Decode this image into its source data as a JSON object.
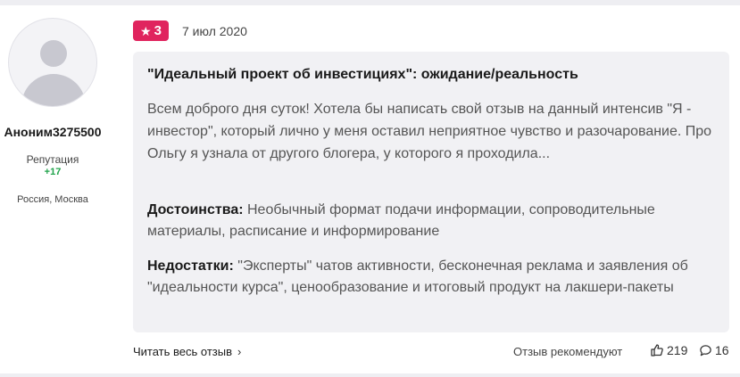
{
  "author": {
    "name": "Аноним3275500",
    "reputation_label": "Репутация",
    "reputation_value": "+17",
    "location": "Россия, Москва"
  },
  "review": {
    "rating": "3",
    "date": "7 июл 2020",
    "title": "\"Идеальный проект об инвестициях\": ожидание/реальность",
    "body": "Всем доброго дня суток! Хотела бы написать свой отзыв на данный интенсив \"Я - инвестор\", который лично у меня оставил неприятное чувство и разочарование. Про Ольгу я узнала от другого блогера, у которого я проходила...",
    "pros_label": "Достоинства:",
    "pros_text": "Необычный формат подачи информации, сопроводительные материалы, расписание и информирование",
    "cons_label": "Недостатки:",
    "cons_text": "\"Эксперты\" чатов активности, бесконечная реклама и заявления об \"идеальности курса\", ценообразование и итоговый продукт на лакшери-пакеты"
  },
  "footer": {
    "read_more": "Читать весь отзыв",
    "recommend": "Отзыв рекомендуют",
    "likes": "219",
    "comments": "16"
  },
  "colors": {
    "badge": "#e0245e",
    "reputation": "#1fa34a",
    "card_bg": "#f1f1f4"
  },
  "icons": {
    "rating": "star-icon",
    "read_more": "chevron-right-icon",
    "likes": "thumbs-up-icon",
    "comments": "comment-icon"
  }
}
